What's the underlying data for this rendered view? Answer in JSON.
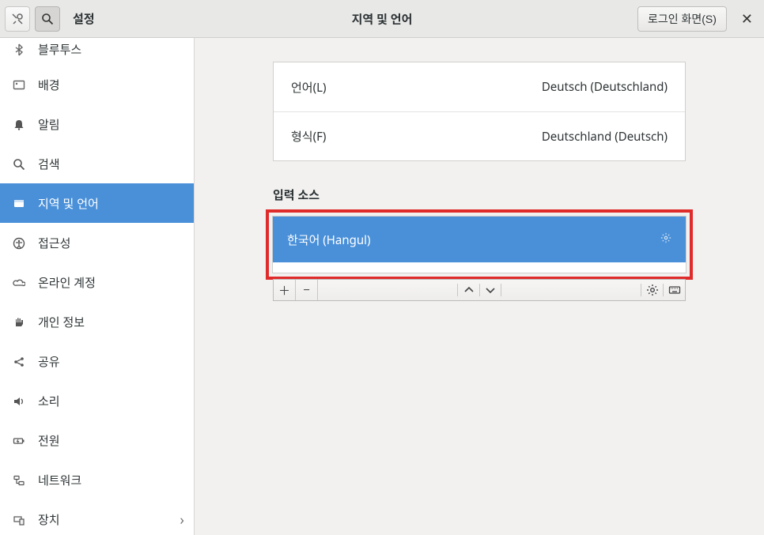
{
  "header": {
    "app_title": "설정",
    "page_title": "지역 및 언어",
    "login_btn": "로그인 화면(S)"
  },
  "sidebar": {
    "items": [
      {
        "id": "bluetooth",
        "label": "블루투스"
      },
      {
        "id": "background",
        "label": "배경"
      },
      {
        "id": "notifications",
        "label": "알림"
      },
      {
        "id": "search",
        "label": "검색"
      },
      {
        "id": "region",
        "label": "지역 및 언어"
      },
      {
        "id": "a11y",
        "label": "접근성"
      },
      {
        "id": "online",
        "label": "온라인 계정"
      },
      {
        "id": "privacy",
        "label": "개인 정보"
      },
      {
        "id": "share",
        "label": "공유"
      },
      {
        "id": "sound",
        "label": "소리"
      },
      {
        "id": "power",
        "label": "전원"
      },
      {
        "id": "network",
        "label": "네트워크"
      },
      {
        "id": "device",
        "label": "장치"
      }
    ]
  },
  "region": {
    "language_label": "언어(L)",
    "language_value": "Deutsch (Deutschland)",
    "format_label": "형식(F)",
    "format_value": "Deutschland (Deutsch)",
    "input_sources_label": "입력 소스",
    "input_source_item": "한국어 (Hangul)"
  }
}
